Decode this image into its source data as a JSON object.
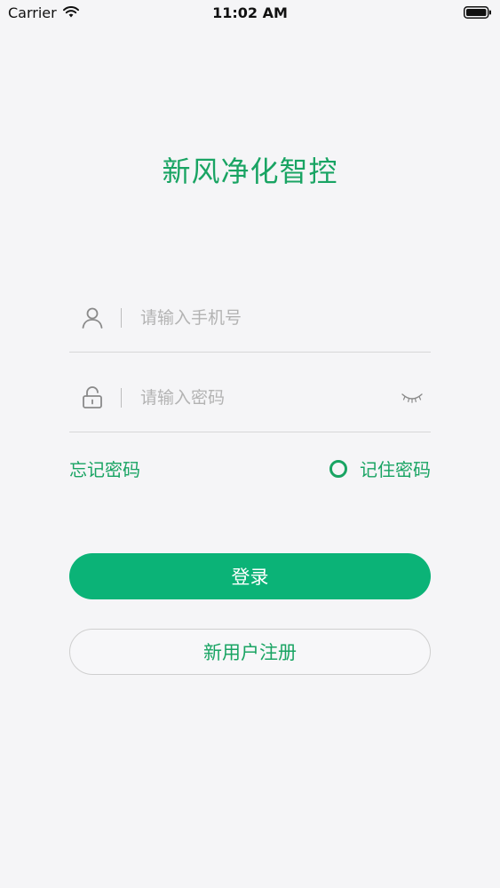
{
  "status_bar": {
    "carrier": "Carrier",
    "time": "11:02 AM"
  },
  "app": {
    "title": "新风净化智控"
  },
  "form": {
    "phone_placeholder": "请输入手机号",
    "password_placeholder": "请输入密码",
    "forgot_password": "忘记密码",
    "remember_password": "记住密码"
  },
  "buttons": {
    "login": "登录",
    "register": "新用户注册"
  },
  "colors": {
    "accent": "#19a463",
    "primary_button": "#0bb377",
    "background": "#f5f5f7"
  },
  "icons": {
    "phone_field": "user-icon",
    "password_field": "unlock-icon",
    "password_toggle": "eye-closed-icon",
    "status_wifi": "wifi-icon",
    "status_battery": "battery-icon"
  }
}
